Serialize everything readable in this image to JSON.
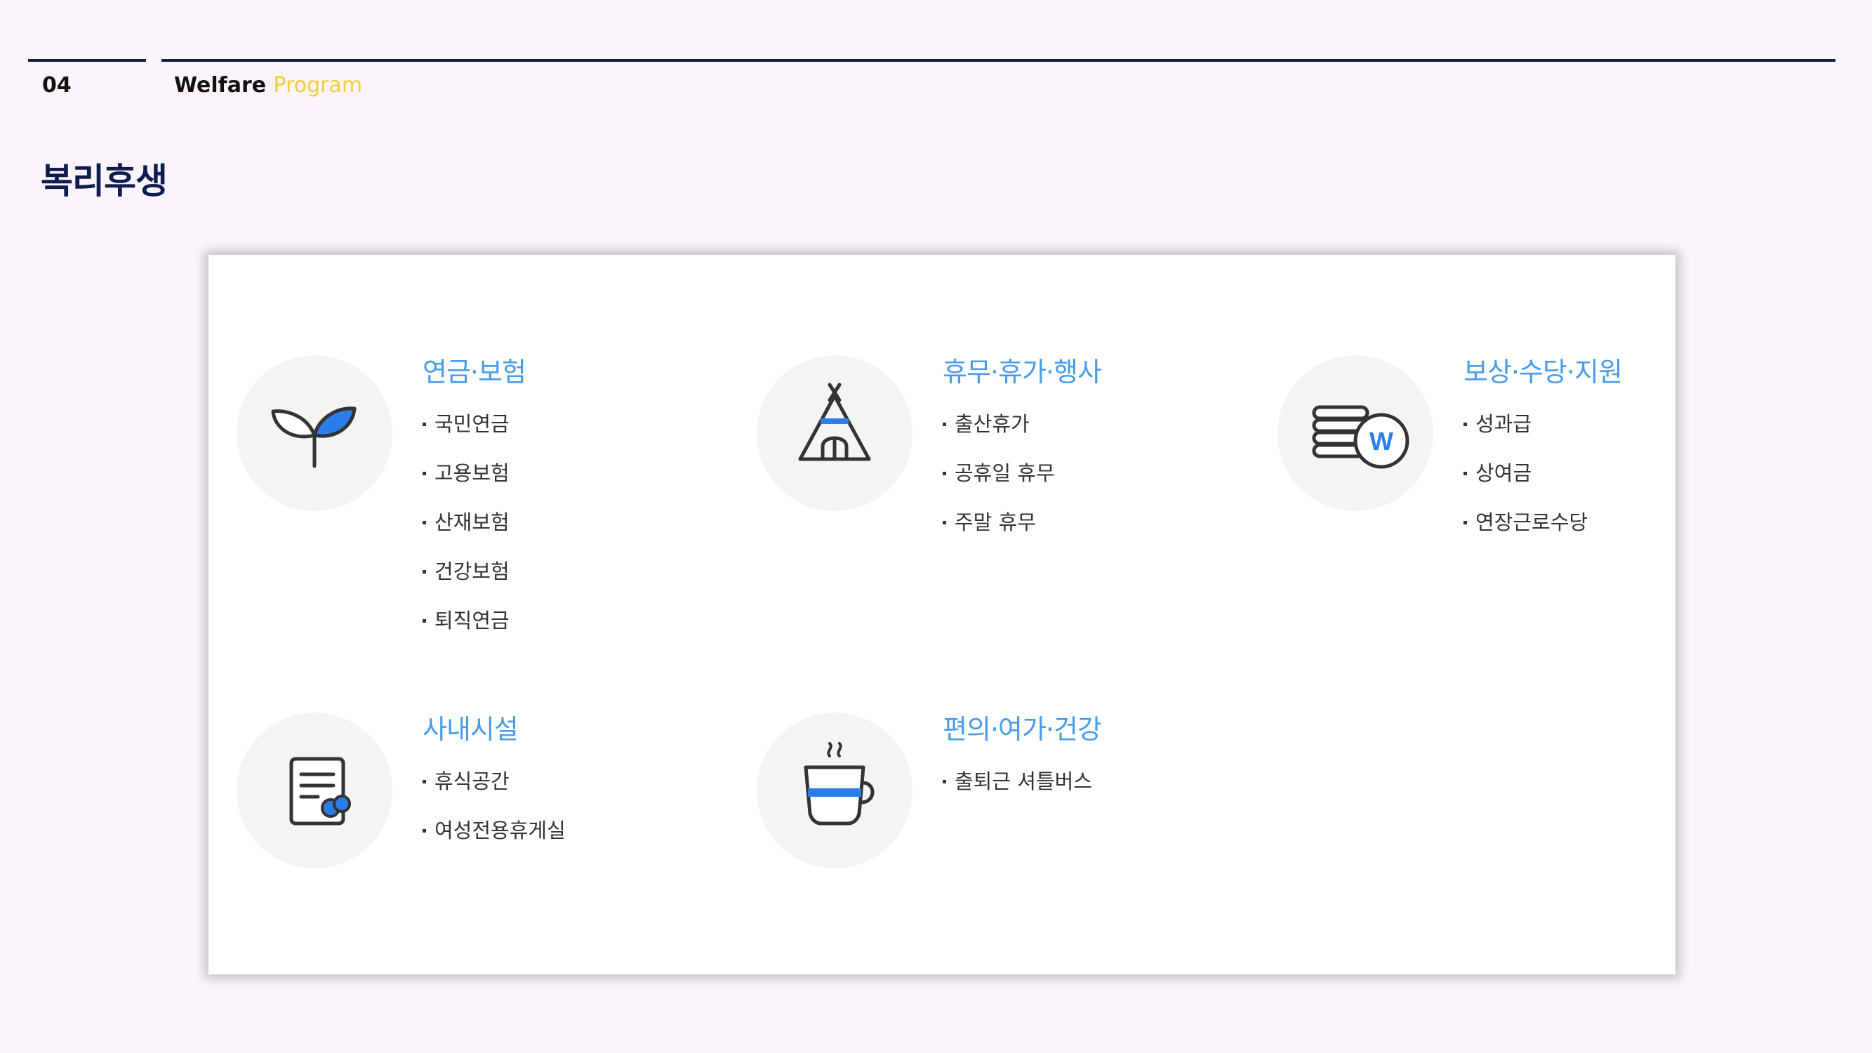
{
  "header": {
    "page_number": "04",
    "section_word1": "Welfare",
    "section_word2": "Program"
  },
  "title": "복리후생",
  "colors": {
    "accent_blue": "#4a9be8",
    "navy": "#0f1c4d",
    "yellow": "#f0cd3c"
  },
  "categories": [
    {
      "icon": "sprout-icon",
      "title": "연금·보험",
      "items": [
        "국민연금",
        "고용보험",
        "산재보험",
        "건강보험",
        "퇴직연금"
      ]
    },
    {
      "icon": "tent-icon",
      "title": "휴무·휴가·행사",
      "items": [
        "출산휴가",
        "공휴일 휴무",
        "주말 휴무"
      ]
    },
    {
      "icon": "coins-icon",
      "title": "보상·수당·지원",
      "items": [
        "성과급",
        "상여금",
        "연장근로수당"
      ],
      "icon_text": "W"
    },
    {
      "icon": "document-icon",
      "title": "사내시설",
      "items": [
        "휴식공간",
        "여성전용휴게실"
      ]
    },
    {
      "icon": "coffee-cup-icon",
      "title": "편의·여가·건강",
      "items": [
        "출퇴근 셔틀버스"
      ]
    }
  ]
}
